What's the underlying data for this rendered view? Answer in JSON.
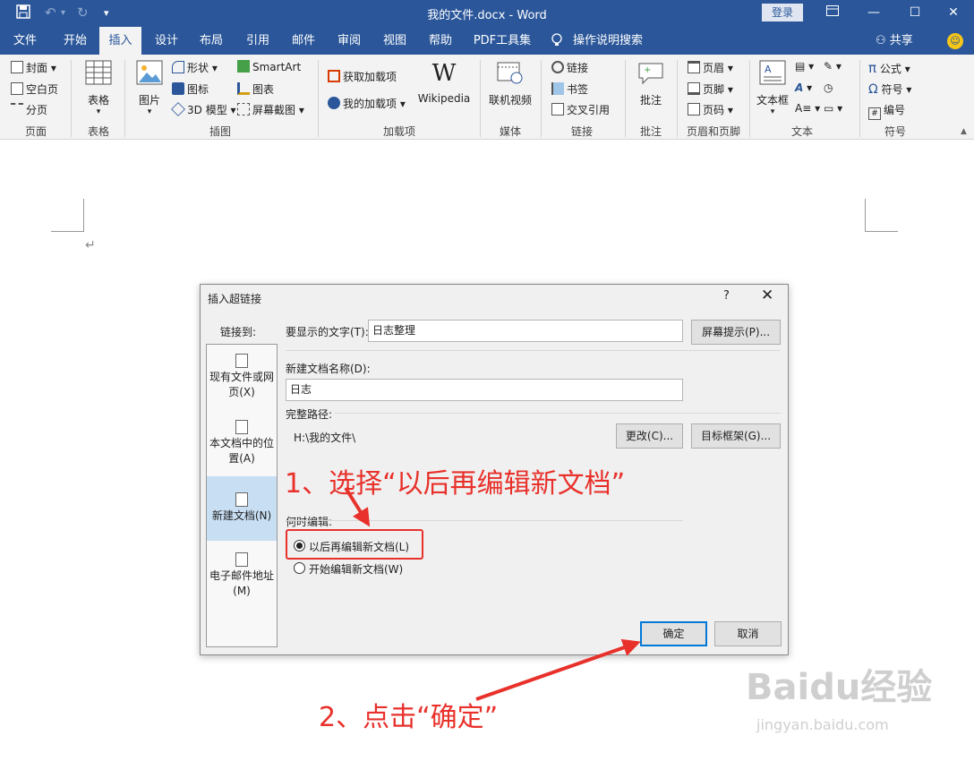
{
  "window": {
    "title": "我的文件.docx  -  Word",
    "login_label": "登录"
  },
  "tabs": [
    "文件",
    "开始",
    "插入",
    "设计",
    "布局",
    "引用",
    "邮件",
    "审阅",
    "视图",
    "帮助",
    "PDF工具集"
  ],
  "active_tab": "插入",
  "tell_me": "操作说明搜索",
  "share_label": "共享",
  "ribbon": {
    "pages": {
      "group": "页面",
      "items": [
        "封面",
        "空白页",
        "分页"
      ]
    },
    "table": {
      "group": "表格",
      "button": "表格"
    },
    "illustrations": {
      "group": "插图",
      "picture": "图片",
      "items": [
        "形状",
        "图标",
        "3D 模型"
      ],
      "items2": [
        "SmartArt",
        "图表",
        "屏幕截图"
      ]
    },
    "addins": {
      "group": "加载项",
      "items": [
        "获取加载项",
        "我的加载项"
      ],
      "wikipedia": "Wikipedia"
    },
    "media": {
      "group": "媒体",
      "button": "联机视频"
    },
    "links": {
      "group": "链接",
      "items": [
        "链接",
        "书签",
        "交叉引用"
      ]
    },
    "comments": {
      "group": "批注",
      "button": "批注"
    },
    "header_footer": {
      "group": "页眉和页脚",
      "items": [
        "页眉",
        "页脚",
        "页码"
      ]
    },
    "text": {
      "group": "文本",
      "button": "文本框"
    },
    "symbols": {
      "group": "符号",
      "items": [
        "公式",
        "符号",
        "编号"
      ]
    }
  },
  "dialog": {
    "title": "插入超链接",
    "help": "?",
    "link_to_label": "链接到:",
    "link_options": [
      "现有文件或网页(X)",
      "本文档中的位置(A)",
      "新建文档(N)",
      "电子邮件地址(M)"
    ],
    "selected_link_option": "新建文档(N)",
    "display_text_label": "要显示的文字(T):",
    "display_text_value": "日志整理",
    "screen_tip_button": "屏幕提示(P)...",
    "new_doc_name_label": "新建文档名称(D):",
    "new_doc_name_value": "日志",
    "full_path_label": "完整路径:",
    "full_path_value": "H:\\我的文件\\",
    "change_button": "更改(C)...",
    "target_frame_button": "目标框架(G)...",
    "when_to_edit_label": "何时编辑:",
    "radio_options": [
      "以后再编辑新文档(L)",
      "开始编辑新文档(W)"
    ],
    "radio_selected": "以后再编辑新文档(L)",
    "ok_button": "确定",
    "cancel_button": "取消"
  },
  "annotations": {
    "step1": "1、选择“以后再编辑新文档”",
    "step2": "2、点击“确定”",
    "color": "#e8312b"
  },
  "watermark": {
    "brand": "Baidu经验",
    "url": "jingyan.baidu.com"
  }
}
